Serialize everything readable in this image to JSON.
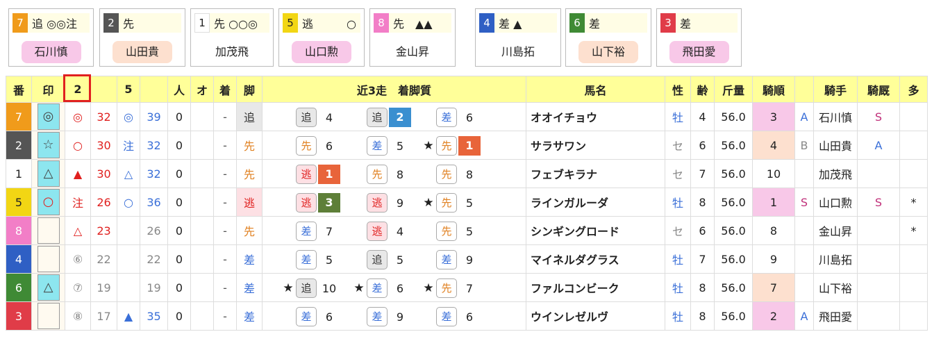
{
  "cards": [
    {
      "num": "7",
      "num_bg": "#f09b1b",
      "num_fg": "#ffffff",
      "text": "追 ◎◎注",
      "jockey": "石川慎",
      "jockey_bg": "#f8c8e8"
    },
    {
      "num": "2",
      "num_bg": "#555555",
      "num_fg": "#ffffff",
      "text": "先",
      "jockey": "山田貴",
      "jockey_bg": "#fde0cf"
    },
    {
      "num": "1",
      "num_bg": "#ffffff",
      "num_fg": "#222222",
      "text": "先 ○○◎",
      "jockey": "加茂飛",
      "jockey_bg": "#ffffff"
    },
    {
      "num": "5",
      "num_bg": "#f2d614",
      "num_fg": "#222222",
      "text": "逃　　　○",
      "jockey": "山口勲",
      "jockey_bg": "#f8c8e8"
    },
    {
      "num": "8",
      "num_bg": "#f27ec7",
      "num_fg": "#ffffff",
      "text": "先　▲▲",
      "jockey": "金山昇",
      "jockey_bg": "#ffffff"
    },
    {
      "num": "4",
      "num_bg": "#2f5fc4",
      "num_fg": "#ffffff",
      "text": "差 ▲",
      "jockey": "川島拓",
      "jockey_bg": "#ffffff"
    },
    {
      "num": "6",
      "num_bg": "#3f8a35",
      "num_fg": "#ffffff",
      "text": "差",
      "jockey": "山下裕",
      "jockey_bg": "#fde0cf"
    },
    {
      "num": "3",
      "num_bg": "#e03c48",
      "num_fg": "#ffffff",
      "text": "差",
      "jockey": "飛田愛",
      "jockey_bg": "#f8c8e8"
    }
  ],
  "headers": {
    "ban": "番",
    "shirushi": "印",
    "col2": "2",
    "col5": "5",
    "ninki": "人",
    "odds": "オ",
    "chaku": "着",
    "kyaku": "脚",
    "recent": "近3走　着脚質",
    "name": "馬名",
    "sex": "性",
    "age": "齢",
    "weight": "斤量",
    "kijun": "騎順",
    "jockey": "騎手",
    "kihi": "騎厩",
    "more": "多"
  },
  "rows": [
    {
      "num": "7",
      "num_bg": "#f09b1b",
      "num_fg": "#ffffff",
      "mark": "◎",
      "mark_bg": "#8de6ef",
      "m2": "◎",
      "m2c": "red",
      "v2": "32",
      "v2c": "red",
      "m5": "◎",
      "m5c": "blue",
      "v5": "39",
      "v5c": "blue",
      "ninki": "0",
      "odds": "",
      "chaku": "-",
      "kyaku": "追",
      "kyaku_c": "#333333",
      "kyaku_bg": "#e8e8e8",
      "runs": [
        {
          "star": "",
          "style": "追",
          "pos": "4",
          "rank": ""
        },
        {
          "star": "",
          "style": "追",
          "pos": "",
          "rank": "2",
          "rank_bg": "#3a8fd0"
        },
        {
          "star": "",
          "style": "差",
          "pos": "6",
          "rank": ""
        }
      ],
      "name": "オオイチョウ",
      "sex": "牡",
      "sex_c": "blue",
      "age": "4",
      "weight": "56.0",
      "kijun": "3",
      "kijun_bg": "#f8c8e8",
      "grade": "A",
      "grade_c": "blue",
      "jockey": "石川慎",
      "kihi": "S",
      "kihi_c": "#c0307a",
      "more": ""
    },
    {
      "num": "2",
      "num_bg": "#555555",
      "num_fg": "#ffffff",
      "mark": "☆",
      "mark_bg": "#8de6ef",
      "m2": "○",
      "m2c": "red",
      "v2": "30",
      "v2c": "red",
      "m5": "注",
      "m5c": "blue",
      "v5": "32",
      "v5c": "blue",
      "ninki": "0",
      "odds": "",
      "chaku": "-",
      "kyaku": "先",
      "kyaku_c": "#e08020",
      "kyaku_bg": "#ffffff",
      "runs": [
        {
          "star": "",
          "style": "先",
          "pos": "6",
          "rank": ""
        },
        {
          "star": "",
          "style": "差",
          "pos": "5",
          "rank": ""
        },
        {
          "star": "★",
          "style": "先",
          "pos": "",
          "rank": "1",
          "rank_bg": "#e8643a"
        }
      ],
      "name": "サラサワン",
      "sex": "セ",
      "sex_c": "gray",
      "age": "6",
      "weight": "56.0",
      "kijun": "4",
      "kijun_bg": "#fde0cf",
      "grade": "B",
      "grade_c": "gray",
      "jockey": "山田貴",
      "kihi": "A",
      "kihi_c": "#3a6fd8",
      "more": ""
    },
    {
      "num": "1",
      "num_bg": "#ffffff",
      "num_fg": "#222222",
      "mark": "△",
      "mark_bg": "#8de6ef",
      "m2": "▲",
      "m2c": "red",
      "v2": "30",
      "v2c": "red",
      "m5": "△",
      "m5c": "blue",
      "v5": "32",
      "v5c": "blue",
      "ninki": "0",
      "odds": "",
      "chaku": "-",
      "kyaku": "先",
      "kyaku_c": "#e08020",
      "kyaku_bg": "#ffffff",
      "runs": [
        {
          "star": "",
          "style": "逃",
          "pos": "",
          "rank": "1",
          "rank_bg": "#e8643a"
        },
        {
          "star": "",
          "style": "先",
          "pos": "8",
          "rank": ""
        },
        {
          "star": "",
          "style": "先",
          "pos": "8",
          "rank": ""
        }
      ],
      "name": "フェブキラナ",
      "sex": "セ",
      "sex_c": "gray",
      "age": "7",
      "weight": "56.0",
      "kijun": "10",
      "kijun_bg": "#ffffff",
      "grade": "",
      "grade_c": "gray",
      "jockey": "加茂飛",
      "kihi": "",
      "kihi_c": "#3a6fd8",
      "more": ""
    },
    {
      "num": "5",
      "num_bg": "#f2d614",
      "num_fg": "#222222",
      "mark": "○",
      "mark_bg": "#8de6ef",
      "m2": "注",
      "m2c": "red",
      "v2": "26",
      "v2c": "red",
      "m5": "○",
      "m5c": "blue",
      "v5": "36",
      "v5c": "blue",
      "ninki": "0",
      "odds": "",
      "chaku": "-",
      "kyaku": "逃",
      "kyaku_c": "#e0201f",
      "kyaku_bg": "#fde0e4",
      "runs": [
        {
          "star": "",
          "style": "逃",
          "pos": "",
          "rank": "3",
          "rank_bg": "#5e7f38"
        },
        {
          "star": "",
          "style": "逃",
          "pos": "9",
          "rank": ""
        },
        {
          "star": "★",
          "style": "先",
          "pos": "5",
          "rank": ""
        }
      ],
      "name": "ラインガルーダ",
      "sex": "牡",
      "sex_c": "blue",
      "age": "8",
      "weight": "56.0",
      "kijun": "1",
      "kijun_bg": "#f8c8e8",
      "grade": "S",
      "grade_c": "pink",
      "jockey": "山口勲",
      "kihi": "S",
      "kihi_c": "#c0307a",
      "more": "*"
    },
    {
      "num": "8",
      "num_bg": "#f27ec7",
      "num_fg": "#ffffff",
      "mark": "",
      "mark_bg": "#fffaf0",
      "m2": "△",
      "m2c": "red",
      "v2": "23",
      "v2c": "red",
      "m5": "",
      "m5c": "gray",
      "v5": "26",
      "v5c": "gray",
      "ninki": "0",
      "odds": "",
      "chaku": "-",
      "kyaku": "先",
      "kyaku_c": "#e08020",
      "kyaku_bg": "#ffffff",
      "runs": [
        {
          "star": "",
          "style": "差",
          "pos": "7",
          "rank": ""
        },
        {
          "star": "",
          "style": "逃",
          "pos": "4",
          "rank": ""
        },
        {
          "star": "",
          "style": "先",
          "pos": "5",
          "rank": ""
        }
      ],
      "name": "シンギングロード",
      "sex": "セ",
      "sex_c": "gray",
      "age": "6",
      "weight": "56.0",
      "kijun": "8",
      "kijun_bg": "#ffffff",
      "grade": "",
      "grade_c": "gray",
      "jockey": "金山昇",
      "kihi": "",
      "kihi_c": "#3a6fd8",
      "more": "*"
    },
    {
      "num": "4",
      "num_bg": "#2f5fc4",
      "num_fg": "#ffffff",
      "mark": "",
      "mark_bg": "#fffaf0",
      "m2": "⑥",
      "m2c": "gray",
      "v2": "22",
      "v2c": "gray",
      "m5": "",
      "m5c": "gray",
      "v5": "22",
      "v5c": "gray",
      "ninki": "0",
      "odds": "",
      "chaku": "-",
      "kyaku": "差",
      "kyaku_c": "#3a6fd8",
      "kyaku_bg": "#ffffff",
      "runs": [
        {
          "star": "",
          "style": "差",
          "pos": "5",
          "rank": ""
        },
        {
          "star": "",
          "style": "追",
          "pos": "5",
          "rank": ""
        },
        {
          "star": "",
          "style": "差",
          "pos": "9",
          "rank": ""
        }
      ],
      "name": "マイネルダグラス",
      "sex": "牡",
      "sex_c": "blue",
      "age": "7",
      "weight": "56.0",
      "kijun": "9",
      "kijun_bg": "#ffffff",
      "grade": "",
      "grade_c": "gray",
      "jockey": "川島拓",
      "kihi": "",
      "kihi_c": "#3a6fd8",
      "more": ""
    },
    {
      "num": "6",
      "num_bg": "#3f8a35",
      "num_fg": "#ffffff",
      "mark": "△",
      "mark_bg": "#8de6ef",
      "m2": "⑦",
      "m2c": "gray",
      "v2": "19",
      "v2c": "gray",
      "m5": "",
      "m5c": "gray",
      "v5": "19",
      "v5c": "gray",
      "ninki": "0",
      "odds": "",
      "chaku": "-",
      "kyaku": "差",
      "kyaku_c": "#3a6fd8",
      "kyaku_bg": "#ffffff",
      "runs": [
        {
          "star": "★",
          "style": "追",
          "pos": "10",
          "rank": ""
        },
        {
          "star": "★",
          "style": "差",
          "pos": "6",
          "rank": ""
        },
        {
          "star": "★",
          "style": "先",
          "pos": "7",
          "rank": ""
        }
      ],
      "name": "ファルコンビーク",
      "sex": "牡",
      "sex_c": "blue",
      "age": "8",
      "weight": "56.0",
      "kijun": "7",
      "kijun_bg": "#fde0cf",
      "grade": "",
      "grade_c": "gray",
      "jockey": "山下裕",
      "kihi": "",
      "kihi_c": "#3a6fd8",
      "more": ""
    },
    {
      "num": "3",
      "num_bg": "#e03c48",
      "num_fg": "#ffffff",
      "mark": "",
      "mark_bg": "#fffaf0",
      "m2": "⑧",
      "m2c": "gray",
      "v2": "17",
      "v2c": "gray",
      "m5": "▲",
      "m5c": "blue",
      "v5": "35",
      "v5c": "blue",
      "ninki": "0",
      "odds": "",
      "chaku": "-",
      "kyaku": "差",
      "kyaku_c": "#3a6fd8",
      "kyaku_bg": "#ffffff",
      "runs": [
        {
          "star": "",
          "style": "差",
          "pos": "6",
          "rank": ""
        },
        {
          "star": "",
          "style": "差",
          "pos": "9",
          "rank": ""
        },
        {
          "star": "",
          "style": "差",
          "pos": "6",
          "rank": ""
        }
      ],
      "name": "ウインレゼルヴ",
      "sex": "牡",
      "sex_c": "blue",
      "age": "8",
      "weight": "56.0",
      "kijun": "2",
      "kijun_bg": "#f8c8e8",
      "grade": "A",
      "grade_c": "blue",
      "jockey": "飛田愛",
      "kihi": "",
      "kihi_c": "#3a6fd8",
      "more": ""
    }
  ],
  "style_colors": {
    "追": "#333333",
    "差": "#3a6fd8",
    "先": "#e08020",
    "逃": "#e0201f"
  },
  "style_bgs": {
    "追": "#e8e8e8",
    "差": "#ffffff",
    "先": "#ffffff",
    "逃": "#fde0e4"
  }
}
